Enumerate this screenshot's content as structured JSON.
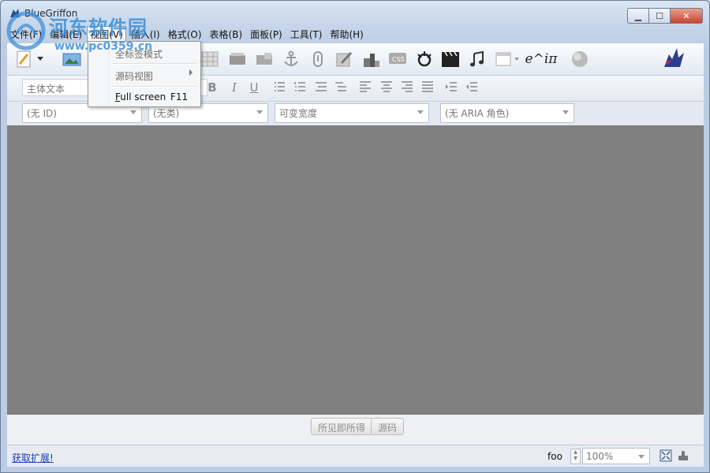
{
  "window": {
    "title": "BlueGriffon",
    "buttons": {
      "minimize": "▁",
      "maximize": "☐",
      "close": "✕"
    }
  },
  "watermark": {
    "text": "河东软件园",
    "url": "www.pc0359.cn"
  },
  "menubar": {
    "items": [
      {
        "label": "文件(F)"
      },
      {
        "label": "编辑(E)"
      },
      {
        "label": "视图(V)"
      },
      {
        "label": "插入(I)"
      },
      {
        "label": "格式(O)"
      },
      {
        "label": "表格(B)"
      },
      {
        "label": "面板(P)"
      },
      {
        "label": "工具(T)"
      },
      {
        "label": "帮助(H)"
      }
    ]
  },
  "view_menu": {
    "items": [
      {
        "label": "全标签模式",
        "enabled": false
      },
      {
        "label": "源码视图",
        "enabled": false,
        "submenu": true
      },
      {
        "label": "Full screen",
        "accelerator_letter": "F",
        "shortcut": "F11",
        "enabled": true
      }
    ]
  },
  "toolbar_main": {
    "icons": [
      "new-document-icon",
      "image-icon",
      "table-icon",
      "form-icon",
      "form-field-icon",
      "anchor-icon",
      "attachment-icon",
      "edit-icon",
      "blocks-icon",
      "css-icon",
      "styles-icon",
      "video-icon",
      "audio-icon",
      "window-icon",
      "math-icon",
      "globe-icon",
      "bluegriffon-logo"
    ],
    "math_label": "e^iπ"
  },
  "toolbar_format": {
    "paragraph_style": "主体文本",
    "buttons": {
      "bold": "B",
      "italic": "I",
      "underline": "U"
    }
  },
  "toolbar_attributes": {
    "id_select": "(无 ID)",
    "class_select": "(无类)",
    "width_select": "可变宽度",
    "aria_select": "(无 ARIA 角色)"
  },
  "view_tabs": {
    "wysiwyg": "所见即所得",
    "source": "源码"
  },
  "statusbar": {
    "extensions_link": "获取扩展!",
    "language": "foo",
    "zoom": "100%"
  },
  "colors": {
    "edit_area": "#808080",
    "window_chrome": "#c9d7ea",
    "link": "#1a3fb5"
  }
}
